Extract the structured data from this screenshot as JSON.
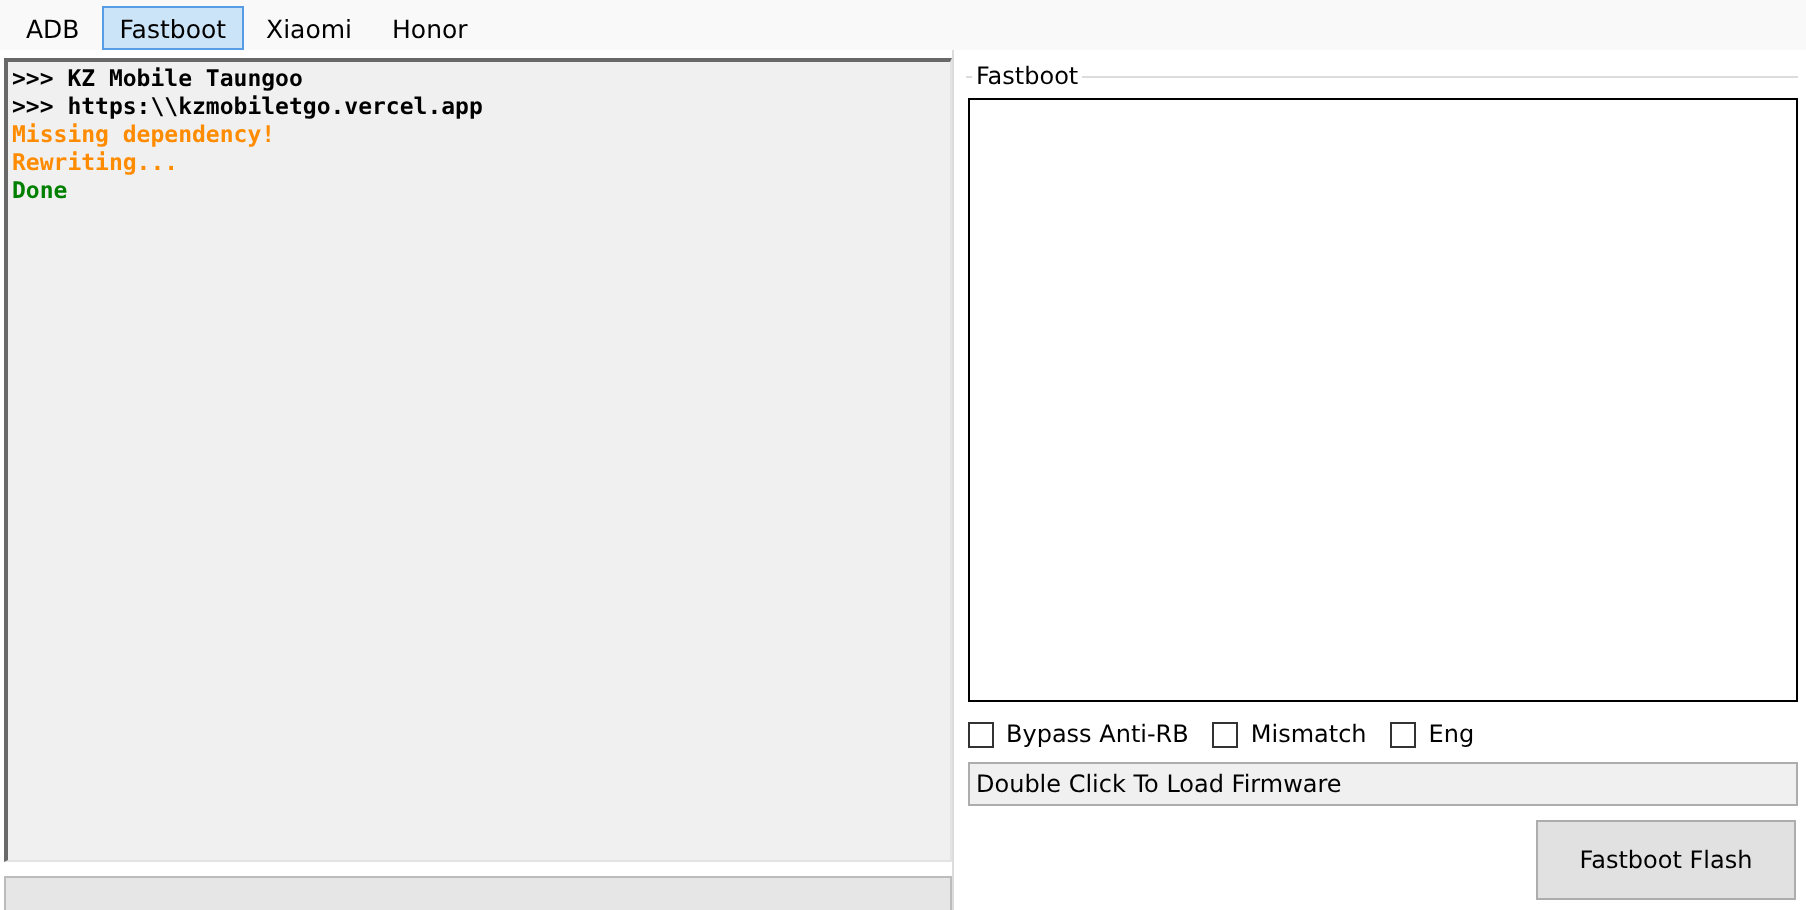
{
  "tabs": [
    {
      "label": "ADB",
      "selected": false
    },
    {
      "label": "Fastboot",
      "selected": true
    },
    {
      "label": "Xiaomi",
      "selected": false
    },
    {
      "label": "Honor",
      "selected": false
    }
  ],
  "log": [
    {
      "text": ">>> KZ Mobile Taungoo",
      "color": "#000000"
    },
    {
      "text": ">>> https:\\\\kzmobiletgo.vercel.app",
      "color": "#000000"
    },
    {
      "text": "Missing dependency!",
      "color": "#ff8c00"
    },
    {
      "text": "Rewriting...",
      "color": "#ff8c00"
    },
    {
      "text": "Done",
      "color": "#008000"
    }
  ],
  "progress": {
    "level": 0
  },
  "fastboot_group": {
    "title": "Fastboot",
    "options": [
      {
        "label": "Bypass Anti-RB",
        "checked": false
      },
      {
        "label": "Mismatch",
        "checked": false
      },
      {
        "label": "Eng",
        "checked": false
      }
    ],
    "firmware_field": {
      "placeholder": "Double Click To Load Firmware"
    },
    "flash_button": "Fastboot Flash"
  }
}
